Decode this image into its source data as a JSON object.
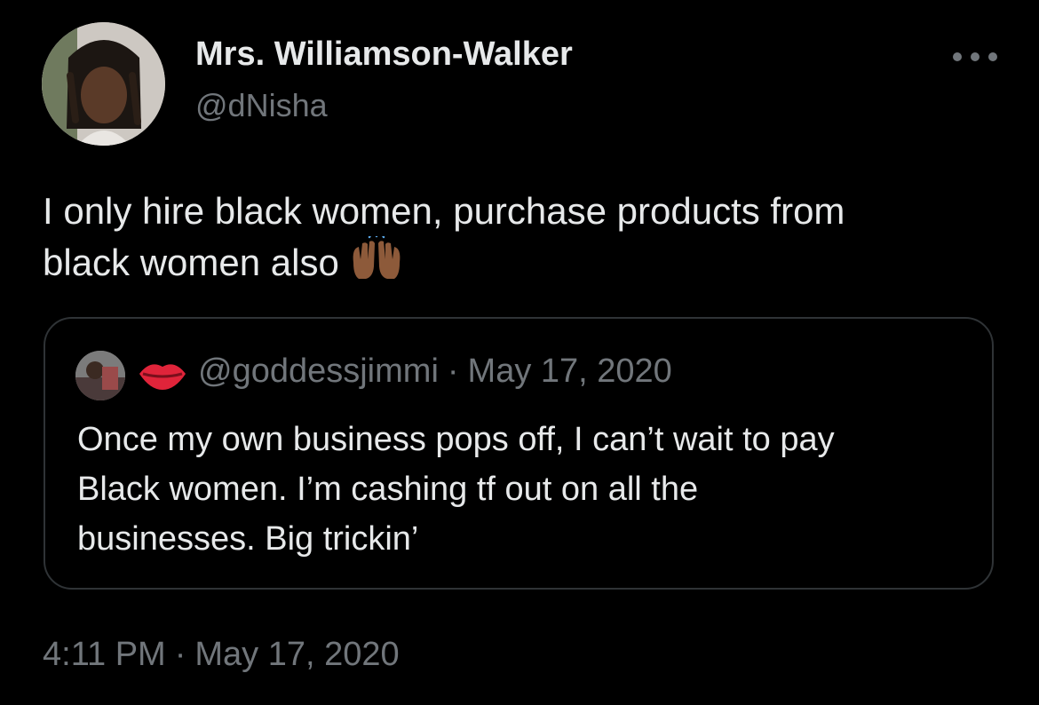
{
  "author": {
    "display_name": "Mrs. Williamson-Walker",
    "handle": "@dNisha"
  },
  "tweet": {
    "text_lines": [
      "I only hire black women, purchase products from",
      "black women also"
    ],
    "emoji": "raising-hands-medium-dark-skin"
  },
  "quote": {
    "handle": "@goddessjimmi",
    "separator": "·",
    "date": "May 17, 2020",
    "name_emoji": "kiss-mark",
    "text_lines": [
      "Once my own business pops off, I can’t wait to pay",
      "Black women. I’m cashing tf out on all the",
      "businesses. Big trickin’"
    ]
  },
  "timestamp": {
    "time": "4:11 PM",
    "separator": "·",
    "date": "May 17, 2020"
  },
  "icons": {
    "more": "more-horizontal-icon",
    "lips": "kiss-mark-icon",
    "hands": "raising-hands-icon"
  },
  "colors": {
    "background": "#000000",
    "primary_text": "#e7e9ea",
    "secondary_text": "#71767b",
    "border": "#2f3336"
  }
}
